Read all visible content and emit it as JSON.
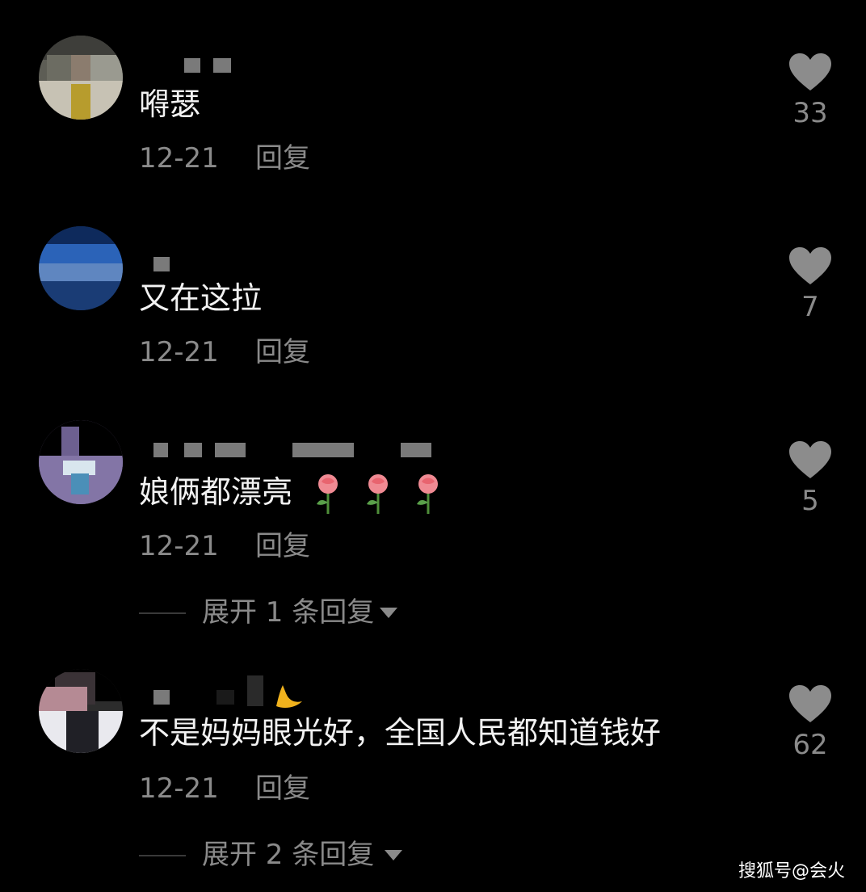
{
  "comments": [
    {
      "content": "嘚瑟",
      "date": "12-21",
      "reply_label": "回复",
      "likes": "33"
    },
    {
      "content": "又在这拉",
      "date": "12-21",
      "reply_label": "回复",
      "likes": "7"
    },
    {
      "content": "娘俩都漂亮",
      "date": "12-21",
      "reply_label": "回复",
      "likes": "5",
      "expand_label": "展开 1 条回复"
    },
    {
      "content": "不是妈妈眼光好，全国人民都知道钱好",
      "date": "12-21",
      "reply_label": "回复",
      "likes": "62",
      "expand_label": "展开 2 条回复"
    }
  ],
  "watermark": "搜狐号@会火",
  "colors": {
    "background": "#000000",
    "text_primary": "#f2f2f2",
    "text_secondary": "#8a8a8a",
    "heart": "#8c8c8c"
  },
  "icons": {
    "like": "heart-icon",
    "expand": "triangle-down-icon",
    "emoji": "rose-emoji",
    "badge": "moon-badge-icon"
  }
}
